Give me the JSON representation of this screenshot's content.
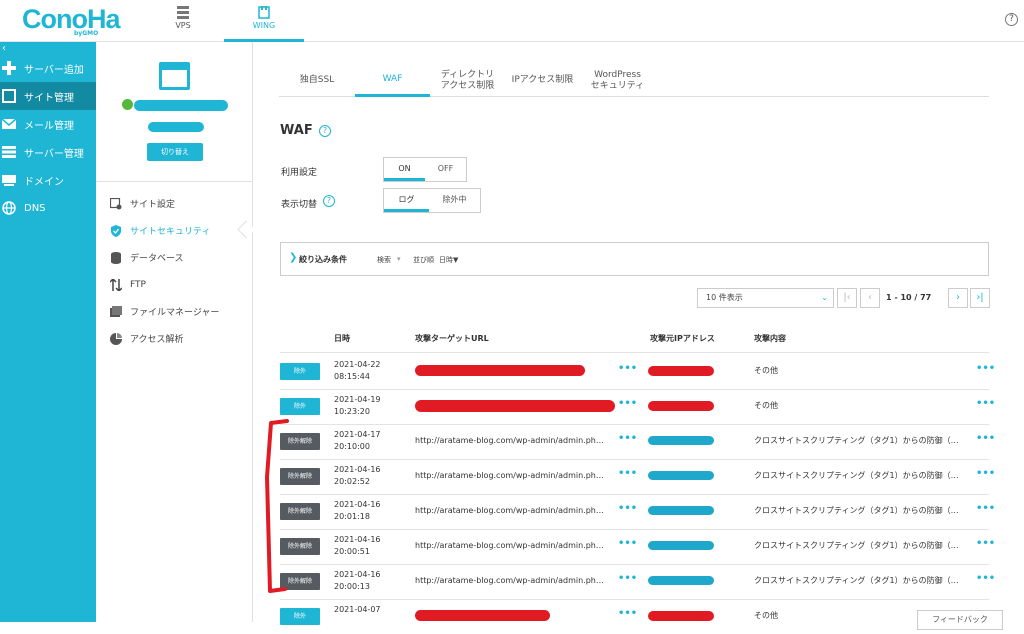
{
  "brand": {
    "logo": "ConoHa",
    "logo_sub": "byGMO"
  },
  "top_tabs": [
    {
      "label": "VPS",
      "icon": "server-icon"
    },
    {
      "label": "WING",
      "icon": "wing-icon"
    }
  ],
  "help_glyph": "?",
  "sidebar": {
    "collapse_glyph": "‹",
    "items": [
      {
        "label": "サーバー追加",
        "icon": "plus-icon"
      },
      {
        "label": "サイト管理",
        "icon": "site-icon"
      },
      {
        "label": "メール管理",
        "icon": "mail-icon"
      },
      {
        "label": "サーバー管理",
        "icon": "server-icon"
      },
      {
        "label": "ドメイン",
        "icon": "domain-icon"
      },
      {
        "label": "DNS",
        "icon": "globe-icon"
      }
    ]
  },
  "site_card": {
    "switch_label": "切り替え"
  },
  "sub_nav": [
    {
      "label": "サイト設定",
      "icon": "settings-icon"
    },
    {
      "label": "サイトセキュリティ",
      "icon": "shield-icon"
    },
    {
      "label": "データベース",
      "icon": "database-icon"
    },
    {
      "label": "FTP",
      "icon": "transfer-icon"
    },
    {
      "label": "ファイルマネージャー",
      "icon": "folder-icon"
    },
    {
      "label": "アクセス解析",
      "icon": "pie-chart-icon"
    }
  ],
  "security_tabs": [
    {
      "line1": "独自SSL",
      "line2": ""
    },
    {
      "line1": "WAF",
      "line2": ""
    },
    {
      "line1": "ディレクトリ",
      "line2": "アクセス制限"
    },
    {
      "line1": "IPアクセス制限",
      "line2": ""
    },
    {
      "line1": "WordPress",
      "line2": "セキュリティ"
    }
  ],
  "waf": {
    "title": "WAF",
    "usage_label": "利用設定",
    "usage_on": "ON",
    "usage_off": "OFF",
    "display_label": "表示切替",
    "display_log": "ログ",
    "display_excluded": "除外中"
  },
  "filter": {
    "chevron": "❯",
    "title": "絞り込み条件",
    "search": "検索",
    "search_caret": "▾",
    "sort_label": "並び順",
    "sort_value": "日時▼"
  },
  "pagination": {
    "per_page": "10 件表示",
    "first": "|‹",
    "prev": "‹",
    "info": "1 - 10 / 77",
    "next": "›",
    "last": "›|"
  },
  "table": {
    "headers": [
      "日時",
      "攻撃ターゲットURL",
      "攻撃元IPアドレス",
      "攻撃内容"
    ],
    "more_glyph": "•••",
    "rows": [
      {
        "action": "除外",
        "state": "exclude",
        "date": "2021-04-22",
        "time": "08:15:44",
        "url": "",
        "detail": "その他"
      },
      {
        "action": "除外",
        "state": "exclude",
        "date": "2021-04-19",
        "time": "10:23:20",
        "url": "",
        "detail": "その他"
      },
      {
        "action": "除外解除",
        "state": "unexclude",
        "date": "2021-04-17",
        "time": "20:10:00",
        "url": "http://aratame-blog.com/wp-admin/admin.ph…",
        "detail": "クロスサイトスクリプティング（タグ1）からの防御（…"
      },
      {
        "action": "除外解除",
        "state": "unexclude",
        "date": "2021-04-16",
        "time": "20:02:52",
        "url": "http://aratame-blog.com/wp-admin/admin.ph…",
        "detail": "クロスサイトスクリプティング（タグ1）からの防御（…"
      },
      {
        "action": "除外解除",
        "state": "unexclude",
        "date": "2021-04-16",
        "time": "20:01:18",
        "url": "http://aratame-blog.com/wp-admin/admin.ph…",
        "detail": "クロスサイトスクリプティング（タグ1）からの防御（…"
      },
      {
        "action": "除外解除",
        "state": "unexclude",
        "date": "2021-04-16",
        "time": "20:00:51",
        "url": "http://aratame-blog.com/wp-admin/admin.ph…",
        "detail": "クロスサイトスクリプティング（タグ1）からの防御（…"
      },
      {
        "action": "除外解除",
        "state": "unexclude",
        "date": "2021-04-16",
        "time": "20:00:13",
        "url": "http://aratame-blog.com/wp-admin/admin.ph…",
        "detail": "クロスサイトスクリプティング（タグ1）からの防御（…"
      },
      {
        "action": "除外",
        "state": "exclude",
        "date": "2021-04-07",
        "time": "",
        "url": "",
        "detail": "その他"
      }
    ]
  },
  "feedback": "フィードバック",
  "colors": {
    "accent": "#1fb6d5",
    "sidebar_active": "#128aa2",
    "badge_dark": "#555b61",
    "redaction_red": "#e01b23"
  }
}
